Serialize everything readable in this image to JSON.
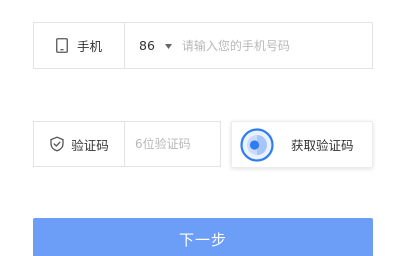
{
  "phone": {
    "label": "手机",
    "icon": "phone-icon",
    "country_code": "86",
    "placeholder": "请输入您的手机号码"
  },
  "verification": {
    "label": "验证码",
    "icon": "shield-check-icon",
    "placeholder": "6位验证码",
    "get_code_label": "获取验证码",
    "captcha_icon": "captcha-target-icon"
  },
  "actions": {
    "next_label": "下一步"
  },
  "colors": {
    "primary": "#6c9df7",
    "accent_blue": "#2f7cf0",
    "border": "#e3e3e3",
    "placeholder": "#b8b8b8",
    "text": "#333333"
  }
}
